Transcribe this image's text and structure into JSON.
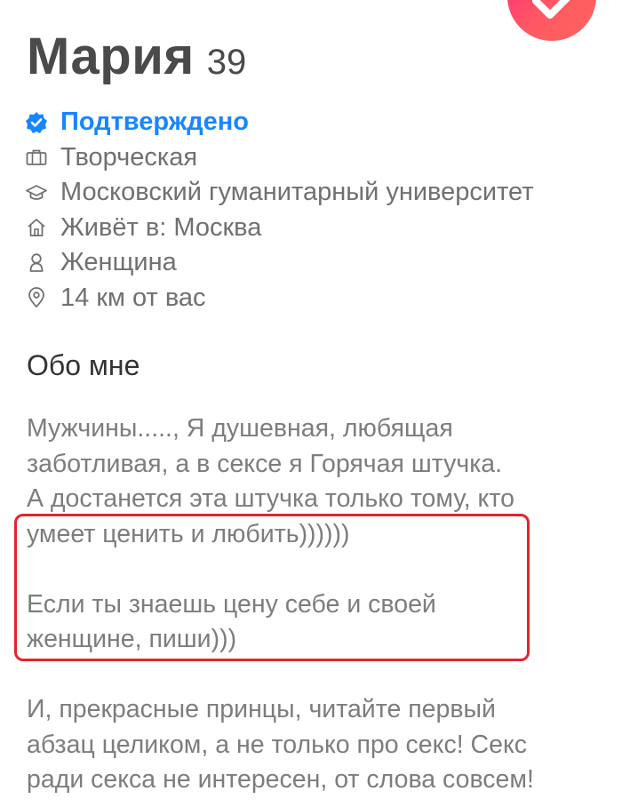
{
  "profile": {
    "name": "Мария",
    "age": "39"
  },
  "info": {
    "verified": "Подтверждено",
    "job": "Творческая",
    "school": "Московский гуманитарный университет",
    "lives": "Живёт в: Москва",
    "gender": "Женщина",
    "distance": "14 км от вас"
  },
  "about": {
    "title": "Обо мне",
    "lines": [
      "Мужчины....., Я душевная, любящая",
      "заботливая, а в сексе я Горячая штучка.",
      "А достанется эта штучка только тому, кто",
      "умеет ценить и любить))))))",
      "",
      "Если ты знаешь цену себе и своей",
      "женщине, пиши)))",
      "",
      "И, прекрасные принцы, читайте первый",
      "абзац целиком, а не только про секс! Секс",
      "ради секса не интересен, от слова совсем!"
    ]
  },
  "colors": {
    "verified": "#1786ff",
    "highlight": "#e1252f",
    "fab_gradient_start": "#fd297b",
    "fab_gradient_end": "#ff655b"
  },
  "icons": {
    "fab": "checkmark-icon",
    "verified": "verified-badge-icon",
    "job": "briefcase-icon",
    "school": "graduation-cap-icon",
    "lives": "home-icon",
    "gender": "person-icon",
    "distance": "location-pin-icon"
  }
}
